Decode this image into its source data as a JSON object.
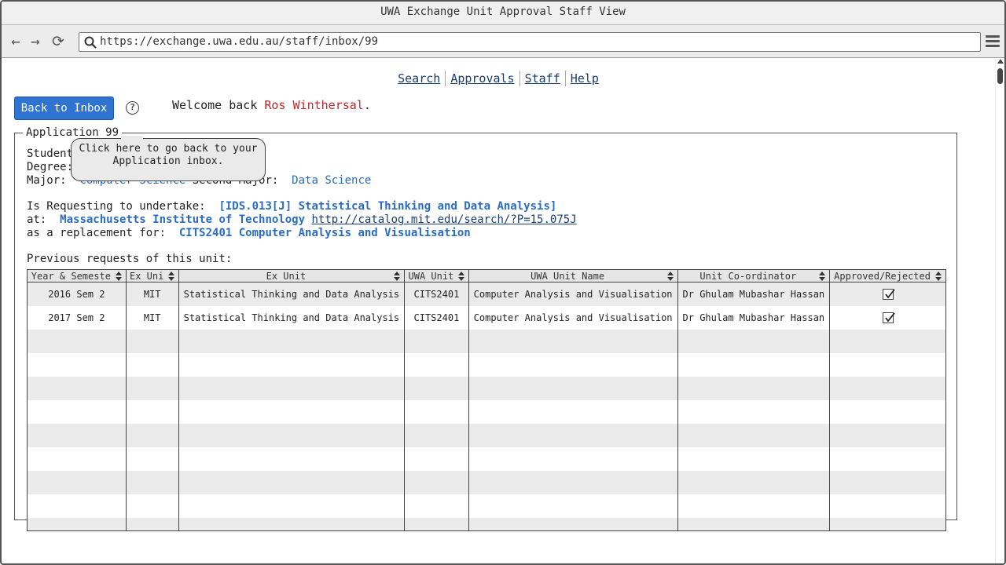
{
  "window": {
    "title": "UWA Exchange Unit Approval Staff View"
  },
  "browser": {
    "url": "https://exchange.uwa.edu.au/staff/inbox/99"
  },
  "nav": {
    "links": [
      "Search",
      "Approvals",
      "Staff",
      "Help"
    ]
  },
  "header": {
    "back_label": "Back to Inbox",
    "help_glyph": "?",
    "welcome_prefix": "Welcome back ",
    "user_name": "Ros Winthersal",
    "welcome_suffix": "."
  },
  "tooltip": {
    "line1": "Click here to go back to your",
    "line2": "Application inbox."
  },
  "application": {
    "legend": "Application 99",
    "student_label": "Student",
    "degree_label": "Degree:",
    "major_label": "Major:",
    "major_value": "Computer Science",
    "second_major_label": "Second Major:",
    "second_major_value": "Data Science",
    "requesting_label": "Is Requesting to undertake:",
    "requesting_unit": "[IDS.013[J] Statistical Thinking and Data Analysis]",
    "at_label": "at:",
    "institution": "Massachusetts Institute of Technology",
    "institution_url": "http://catalog.mit.edu/search/?P=15.075J",
    "replacement_label": "as a replacement for:",
    "replacement_unit": "CITS2401 Computer Analysis and Visualisation",
    "previous_label": "Previous requests of this unit:"
  },
  "table": {
    "columns": [
      "Year & Semeste",
      "Ex Uni",
      "Ex Unit",
      "UWA Unit",
      "UWA Unit Name",
      "Unit Co-ordinator",
      "Approved/Rejected"
    ],
    "rows": [
      [
        "2016 Sem 2",
        "MIT",
        "Statistical Thinking and Data Analysis",
        "CITS2401",
        "Computer Analysis and Visualisation",
        "Dr Ghulam Mubashar Hassan",
        "approved"
      ],
      [
        "2017 Sem 2",
        "MIT",
        "Statistical Thinking and Data Analysis",
        "CITS2401",
        "Computer Analysis and Visualisation",
        "Dr Ghulam Mubashar Hassan",
        "approved"
      ]
    ]
  }
}
